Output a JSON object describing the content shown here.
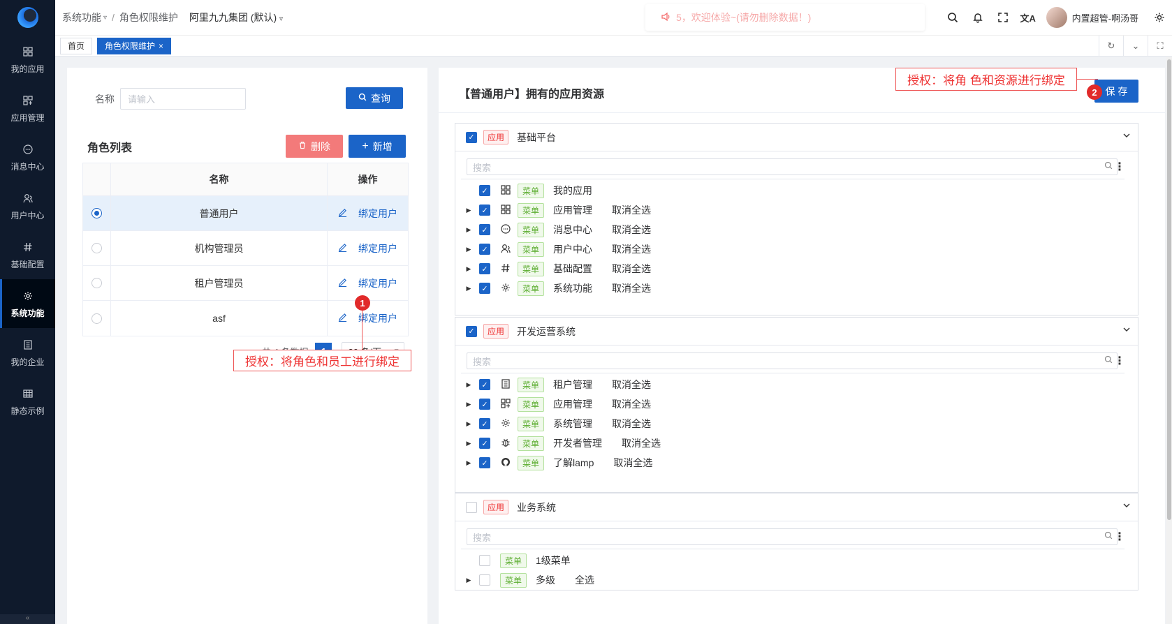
{
  "sidebar": {
    "items": [
      {
        "label": "我的应用",
        "icon": "grid-icon"
      },
      {
        "label": "应用管理",
        "icon": "apps-icon"
      },
      {
        "label": "消息中心",
        "icon": "message-icon"
      },
      {
        "label": "用户中心",
        "icon": "users-icon"
      },
      {
        "label": "基础配置",
        "icon": "hash-icon"
      },
      {
        "label": "系统功能",
        "icon": "gear-icon"
      },
      {
        "label": "我的企业",
        "icon": "building-icon"
      },
      {
        "label": "静态示例",
        "icon": "table-icon"
      }
    ],
    "active_index": 5
  },
  "header": {
    "breadcrumb": [
      "系统功能",
      "角色权限维护"
    ],
    "org": "阿里九九集团 (默认)",
    "notice": "5，欢迎体验~(请勿删除数据！)",
    "user": "内置超管-啊汤哥"
  },
  "tabs": [
    {
      "label": "首页"
    },
    {
      "label": "角色权限维护",
      "close": "×"
    }
  ],
  "left": {
    "search_label": "名称",
    "search_placeholder": "请输入",
    "query_label": "查询",
    "list_title": "角色列表",
    "delete_label": "删除",
    "add_label": "新增",
    "columns": [
      "名称",
      "操作"
    ],
    "rows": [
      {
        "name": "普通用户",
        "action": "绑定用户",
        "selected": true
      },
      {
        "name": "机构管理员",
        "action": "绑定用户",
        "selected": false
      },
      {
        "name": "租户管理员",
        "action": "绑定用户",
        "selected": false
      },
      {
        "name": "asf",
        "action": "绑定用户",
        "selected": false
      }
    ],
    "total_text": "共 4 条数据",
    "page": "1",
    "page_size": "20 条/页",
    "annotation": "授权：将角色和员工进行绑定",
    "annotation_marker": "1"
  },
  "right": {
    "title": "【普通用户】拥有的应用资源",
    "save_label": "保 存",
    "annotation": "授权：将角 色和资源进行绑定",
    "annotation_marker": "2",
    "search_placeholder": "搜索",
    "app_tag": "应用",
    "menu_tag": "菜单",
    "cards": [
      {
        "title": "基础平台",
        "checked": true,
        "items": [
          {
            "name": "我的应用",
            "icon": "grid-icon",
            "checked": true,
            "expandable": false,
            "action": ""
          },
          {
            "name": "应用管理",
            "icon": "grid-icon",
            "checked": true,
            "expandable": true,
            "action": "取消全选"
          },
          {
            "name": "消息中心",
            "icon": "message-icon",
            "checked": true,
            "expandable": true,
            "action": "取消全选"
          },
          {
            "name": "用户中心",
            "icon": "users-icon",
            "checked": true,
            "expandable": true,
            "action": "取消全选"
          },
          {
            "name": "基础配置",
            "icon": "hash-icon",
            "checked": true,
            "expandable": true,
            "action": "取消全选"
          },
          {
            "name": "系统功能",
            "icon": "gear-icon",
            "checked": true,
            "expandable": true,
            "action": "取消全选"
          }
        ]
      },
      {
        "title": "开发运营系统",
        "checked": true,
        "items": [
          {
            "name": "租户管理",
            "icon": "building-icon",
            "checked": true,
            "expandable": true,
            "action": "取消全选"
          },
          {
            "name": "应用管理",
            "icon": "apps-icon",
            "checked": true,
            "expandable": true,
            "action": "取消全选"
          },
          {
            "name": "系统管理",
            "icon": "gear-icon",
            "checked": true,
            "expandable": true,
            "action": "取消全选"
          },
          {
            "name": "开发者管理",
            "icon": "bug-icon",
            "checked": true,
            "expandable": true,
            "action": "取消全选"
          },
          {
            "name": "了解lamp",
            "icon": "github-icon",
            "checked": true,
            "expandable": true,
            "action": "取消全选"
          }
        ]
      },
      {
        "title": "业务系统",
        "checked": false,
        "items": [
          {
            "name": "1级菜单",
            "icon": "",
            "checked": false,
            "expandable": false,
            "action": ""
          },
          {
            "name": "多级",
            "icon": "",
            "checked": false,
            "expandable": true,
            "action": "全选"
          }
        ]
      }
    ]
  },
  "colors": {
    "primary": "#1b64c8",
    "sidebar_bg": "#0f1a2c",
    "danger": "#f37a7a",
    "annotation": "#e33"
  }
}
